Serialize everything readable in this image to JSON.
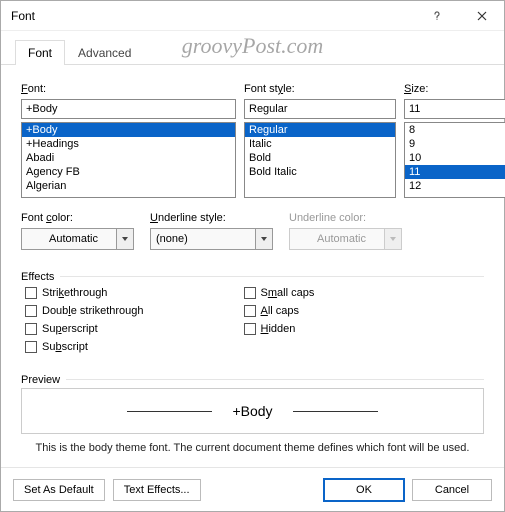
{
  "window": {
    "title": "Font"
  },
  "watermark": "groovyPost.com",
  "tabs": {
    "font": "Font",
    "advanced": "Advanced"
  },
  "font_area": {
    "font_label": "Font:",
    "font_value": "+Body",
    "font_list": [
      "+Body",
      "+Headings",
      "Abadi",
      "Agency FB",
      "Algerian"
    ],
    "font_selected_index": 0,
    "style_label": "Font style:",
    "style_value": "Regular",
    "style_list": [
      "Regular",
      "Italic",
      "Bold",
      "Bold Italic"
    ],
    "style_selected_index": 0,
    "size_label": "Size:",
    "size_value": "11",
    "size_list": [
      "8",
      "9",
      "10",
      "11",
      "12"
    ],
    "size_selected_index": 3
  },
  "mid": {
    "font_color_label": "Font color:",
    "font_color_value": "Automatic",
    "underline_style_label": "Underline style:",
    "underline_style_value": "(none)",
    "underline_color_label": "Underline color:",
    "underline_color_value": "Automatic"
  },
  "effects": {
    "section": "Effects",
    "strikethrough": "Strikethrough",
    "double_strikethrough": "Double strikethrough",
    "superscript": "Superscript",
    "subscript": "Subscript",
    "small_caps": "Small caps",
    "all_caps": "All caps",
    "hidden": "Hidden"
  },
  "preview": {
    "section": "Preview",
    "text": "+Body",
    "tip": "This is the body theme font. The current document theme defines which font will be used."
  },
  "footer": {
    "set_default": "Set As Default",
    "text_effects": "Text Effects...",
    "ok": "OK",
    "cancel": "Cancel"
  }
}
